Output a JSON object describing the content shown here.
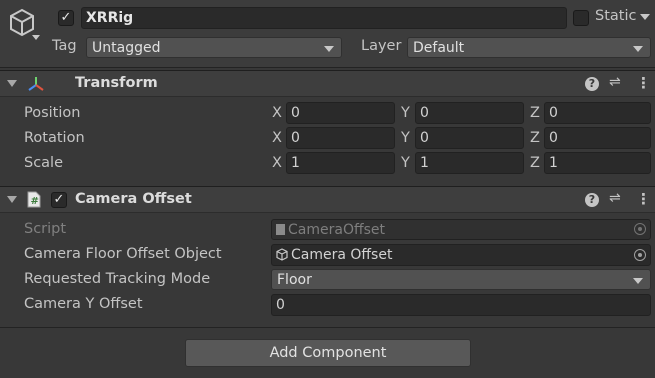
{
  "header": {
    "active_checked": true,
    "object_name": "XRRig",
    "static_label": "Static",
    "static_checked": false,
    "tag_label": "Tag",
    "tag_value": "Untagged",
    "layer_label": "Layer",
    "layer_value": "Default"
  },
  "transform": {
    "title": "Transform",
    "rows": [
      {
        "label": "Position",
        "x": "0",
        "y": "0",
        "z": "0"
      },
      {
        "label": "Rotation",
        "x": "0",
        "y": "0",
        "z": "0"
      },
      {
        "label": "Scale",
        "x": "1",
        "y": "1",
        "z": "1"
      }
    ],
    "axis_labels": {
      "x": "X",
      "y": "Y",
      "z": "Z"
    }
  },
  "camera_offset": {
    "title": "Camera Offset",
    "enabled": true,
    "script_label": "Script",
    "script_value": "CameraOffset",
    "floor_offset_label": "Camera Floor Offset Object",
    "floor_offset_value": "Camera Offset",
    "tracking_mode_label": "Requested Tracking Mode",
    "tracking_mode_value": "Floor",
    "y_offset_label": "Camera Y Offset",
    "y_offset_value": "0"
  },
  "add_component_label": "Add Component",
  "icons": {
    "gameobject": "cube-icon",
    "transform": "transform-axes-icon",
    "script": "script-file-icon",
    "help": "help-icon",
    "presets": "presets-icon",
    "menu": "kebab-menu-icon",
    "object_picker": "object-picker-icon"
  },
  "colors": {
    "background": "#383838",
    "field": "#2a2a2a",
    "header": "#3e3e3e",
    "button": "#585858"
  }
}
